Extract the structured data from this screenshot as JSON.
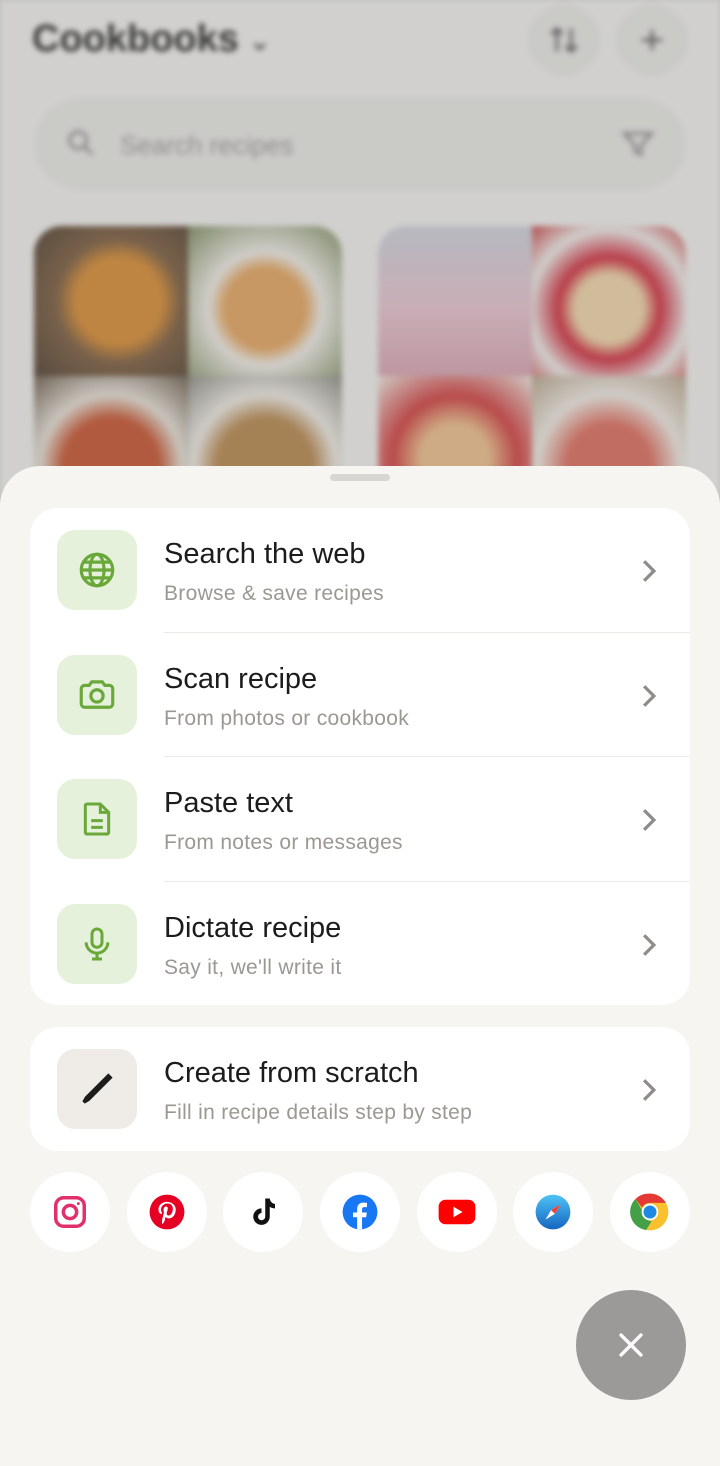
{
  "background": {
    "title": "Cookbooks",
    "search_placeholder": "Search recipes",
    "sort_icon": "sort-icon",
    "add_icon": "plus-icon"
  },
  "sheet": {
    "import_options": [
      {
        "title": "Search the web",
        "subtitle": "Browse & save recipes",
        "icon": "globe-icon"
      },
      {
        "title": "Scan recipe",
        "subtitle": "From photos or cookbook",
        "icon": "camera-icon"
      },
      {
        "title": "Paste text",
        "subtitle": "From notes or messages",
        "icon": "document-icon"
      },
      {
        "title": "Dictate recipe",
        "subtitle": "Say it, we'll write it",
        "icon": "microphone-icon"
      }
    ],
    "create": {
      "title": "Create from scratch",
      "subtitle": "Fill in recipe details step by step",
      "icon": "pencil-icon"
    },
    "social_sources": [
      "instagram-icon",
      "pinterest-icon",
      "tiktok-icon",
      "facebook-icon",
      "youtube-icon",
      "safari-icon",
      "chrome-icon"
    ],
    "close_icon": "close-icon"
  },
  "colors": {
    "accent_green": "#6aa83a",
    "tile_green": "#e6f1dc",
    "sheet_bg": "#f7f5f1",
    "fab_gray": "#9b9a98"
  }
}
